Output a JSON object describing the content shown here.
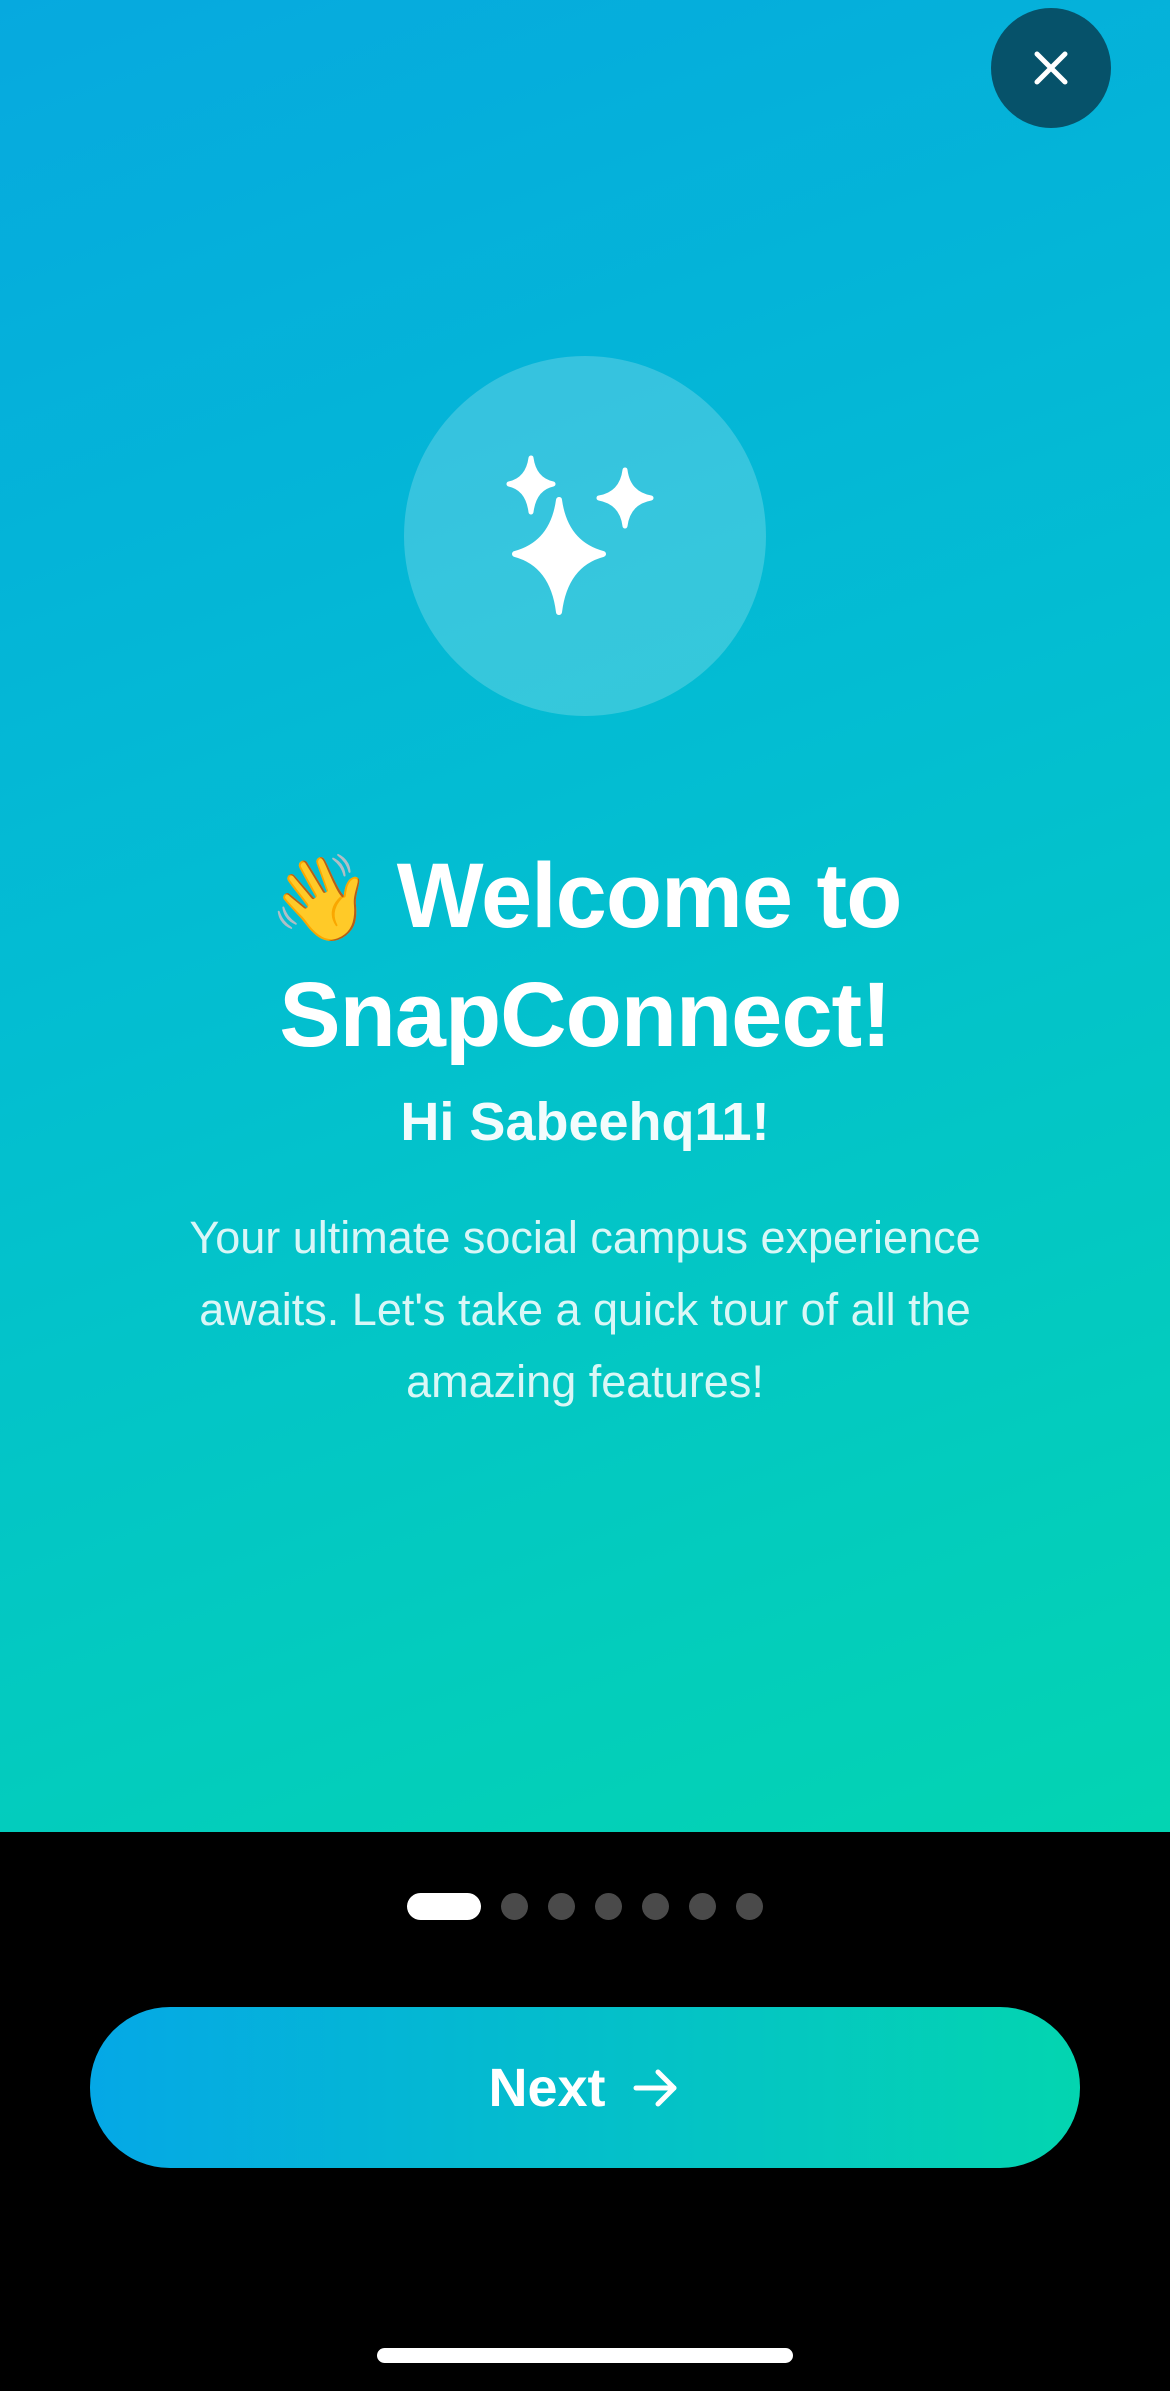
{
  "header": {
    "close_icon": "close-icon"
  },
  "hero": {
    "icon": "sparkles-icon",
    "wave_emoji": "👋",
    "title_line1": "Welcome to",
    "title_line2": "SnapConnect!",
    "greeting": "Hi Sabeehq11!",
    "description": "Your ultimate social campus experience awaits. Let's take a quick tour of all the amazing features!"
  },
  "pager": {
    "total": 7,
    "current": 1
  },
  "footer": {
    "next_label": "Next",
    "next_icon": "arrow-right-icon"
  },
  "colors": {
    "gradient_start": "#06a9df",
    "gradient_end": "#03d4b2",
    "close_button_bg": "#06526a",
    "inactive_dot": "#4a4a4a",
    "active_dot": "#ffffff",
    "footer_bg": "#000000"
  }
}
